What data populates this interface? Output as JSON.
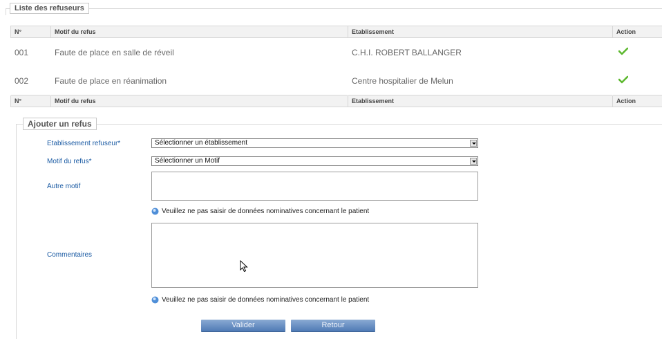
{
  "list_section": {
    "legend": "Liste des refuseurs",
    "columns": [
      "N°",
      "Motif du refus",
      "Etablissement",
      "Action"
    ],
    "rows": [
      {
        "num": "001",
        "motif": "Faute de place en salle de réveil",
        "etablissement": "C.H.I. ROBERT BALLANGER",
        "action_icon": "check-icon"
      },
      {
        "num": "002",
        "motif": "Faute de place en réanimation",
        "etablissement": "Centre hospitalier de Melun",
        "action_icon": "check-icon"
      }
    ]
  },
  "add_section": {
    "legend": "Ajouter un refus",
    "etablissement_label": "Etablissement refuseur*",
    "etablissement_value": "Sélectionner un établissement",
    "motif_label": "Motif du refus*",
    "motif_value": "Sélectionner un Motif",
    "autre_motif_label": "Autre motif",
    "hint_1": "Veuillez ne pas saisir de données nominatives concernant le patient",
    "commentaires_label": "Commentaires",
    "hint_2": "Veuillez ne pas saisir de données nominatives concernant le patient",
    "valider_label": "Valider",
    "retour_label": "Retour"
  },
  "colors": {
    "accent_blue": "#1a5aa3",
    "check_green": "#5cb82e",
    "button_blue": "#4f7ab5"
  }
}
